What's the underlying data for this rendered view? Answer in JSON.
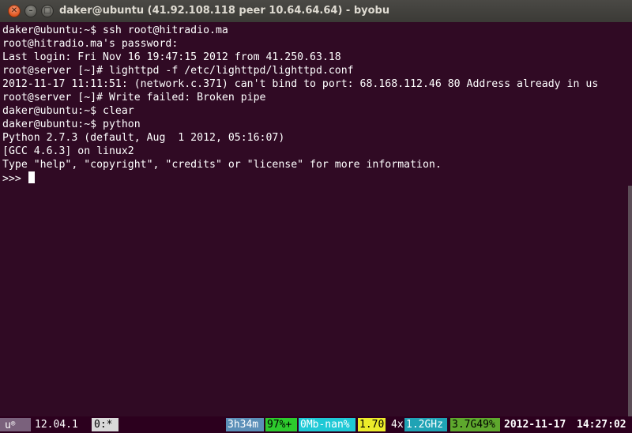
{
  "window": {
    "title": "daker@ubuntu (41.92.108.118 peer 10.64.64.64) - byobu",
    "close_glyph": "✕",
    "minimize_glyph": "–",
    "maximize_glyph": "□"
  },
  "terminal": {
    "lines": [
      "daker@ubuntu:~$ ssh root@hitradio.ma",
      "root@hitradio.ma's password:",
      "Last login: Fri Nov 16 19:47:15 2012 from 41.250.63.18",
      "root@server [~]# lighttpd -f /etc/lighttpd/lighttpd.conf",
      "2012-11-17 11:11:51: (network.c.371) can't bind to port: 68.168.112.46 80 Address already in us",
      "root@server [~]# Write failed: Broken pipe",
      "daker@ubuntu:~$ clear",
      "daker@ubuntu:~$ python",
      "Python 2.7.3 (default, Aug  1 2012, 05:16:07)",
      "[GCC 4.6.3] on linux2",
      "Type \"help\", \"copyright\", \"credits\" or \"license\" for more information.",
      ">>> "
    ]
  },
  "statusbar": {
    "logo": "u",
    "logo_mark": "®",
    "release": "12.04.1",
    "window": "0:*",
    "uptime": "3h34m",
    "cpu": "97%+",
    "network": "0Mb-nan%",
    "load": "1.70",
    "cores": "4x",
    "freq": "1.2GHz",
    "mem": "3.7G49%",
    "date": "2012-11-17",
    "time": "14:27:02"
  },
  "colors": {
    "terminal_bg": "#300a24",
    "text": "#ffffff",
    "close_button": "#e0551f"
  }
}
